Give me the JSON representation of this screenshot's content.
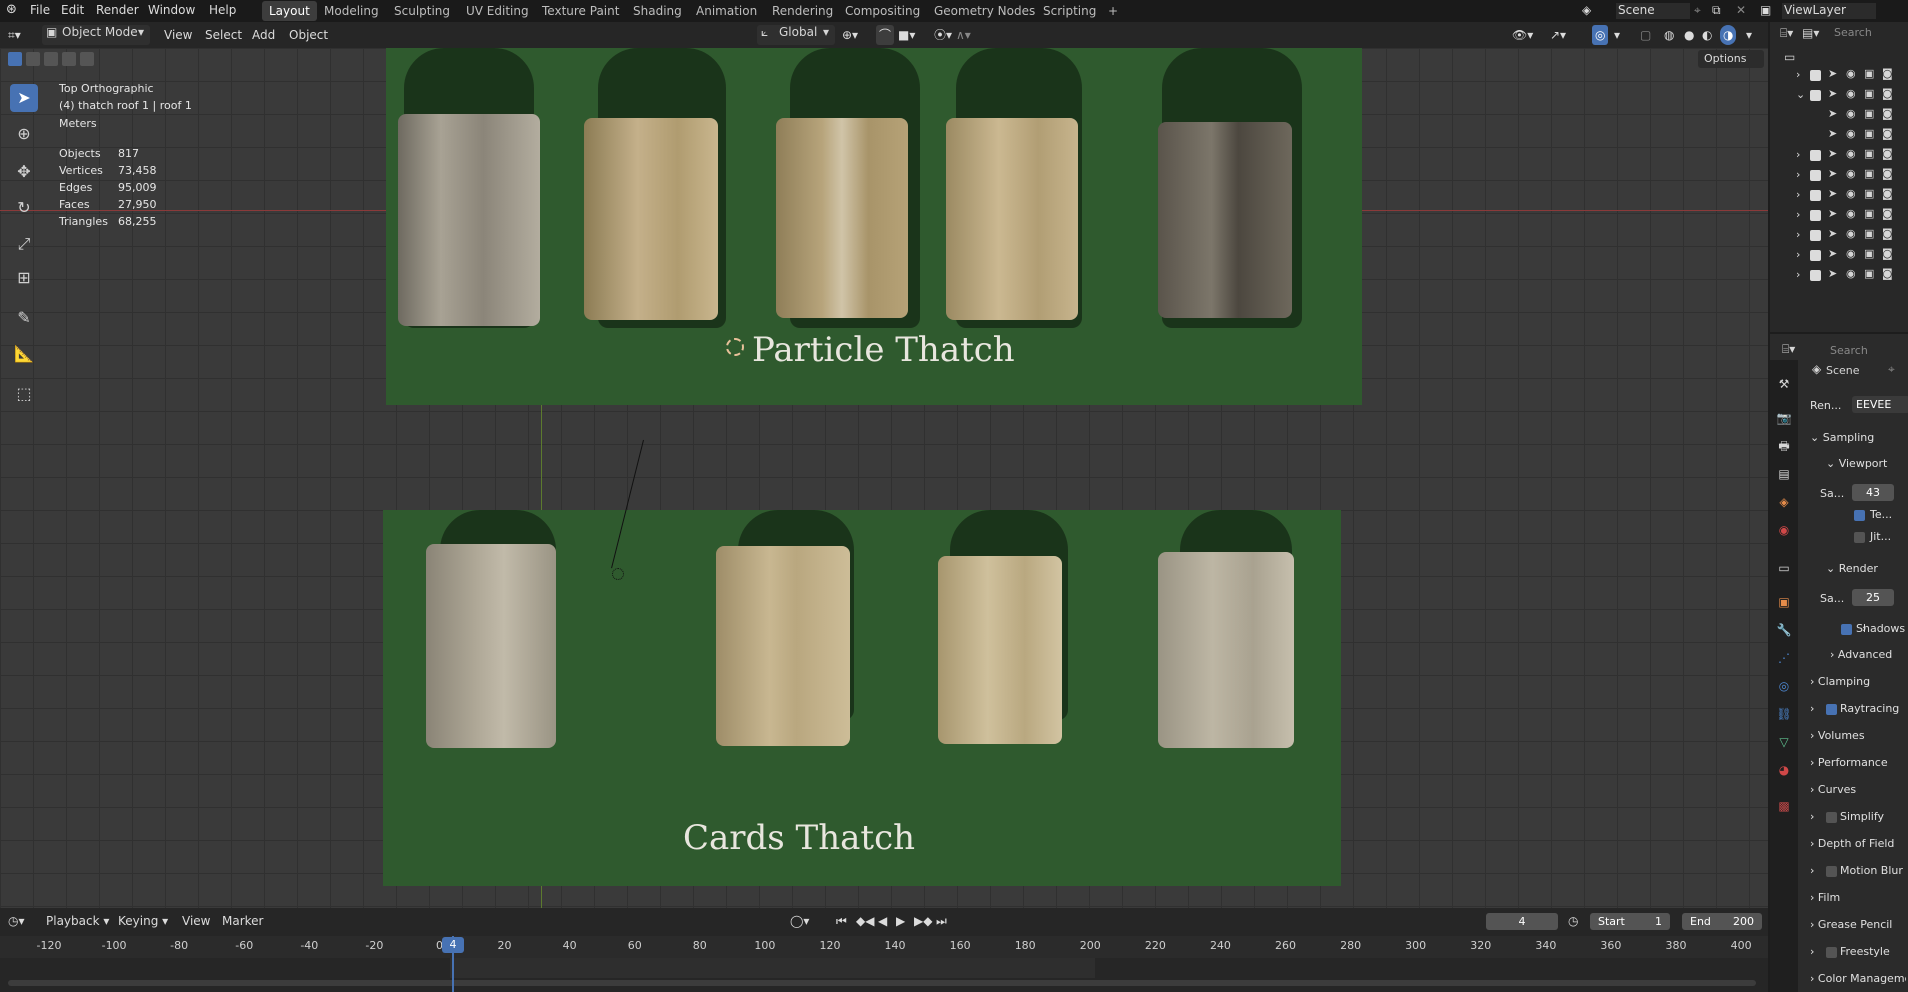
{
  "menu": [
    "File",
    "Edit",
    "Render",
    "Window",
    "Help"
  ],
  "workspaces": [
    "Layout",
    "Modeling",
    "Sculpting",
    "UV Editing",
    "Texture Paint",
    "Shading",
    "Animation",
    "Rendering",
    "Compositing",
    "Geometry Nodes",
    "Scripting",
    "+"
  ],
  "scene_name": "Scene",
  "view_layer": "ViewLayer",
  "header": {
    "mode": "Object Mode",
    "view": "View",
    "select": "Select",
    "add": "Add",
    "object": "Object",
    "transform_orientation": "Global",
    "options": "Options"
  },
  "overlay": {
    "view_name": "Top Orthographic",
    "active": "(4) thatch roof 1 | roof 1",
    "units": "Meters",
    "stats": [
      {
        "label": "Objects",
        "value": "817"
      },
      {
        "label": "Vertices",
        "value": "73,458"
      },
      {
        "label": "Edges",
        "value": "95,009"
      },
      {
        "label": "Faces",
        "value": "27,950"
      },
      {
        "label": "Triangles",
        "value": "68,255"
      }
    ]
  },
  "scene_labels": {
    "particle": "Particle Thatch",
    "cards": "Cards Thatch"
  },
  "colors": {
    "accent": "#4772b3",
    "plane": "#2f5a2e",
    "grid": "#3a3a3a"
  },
  "properties": {
    "search_placeholder": "Search",
    "scene": "Scene",
    "render_label": "Ren...",
    "render_engine": "EEVEE",
    "sections": {
      "sampling": "Sampling",
      "viewport": "Viewport",
      "samples_label": "Sa...",
      "viewport_samples": "43",
      "temporal_label": "Te...",
      "jitter_label": "Jit...",
      "render": "Render",
      "render_samples": "25",
      "shadows": "Shadows",
      "advanced": "Advanced",
      "clamping": "Clamping",
      "raytracing": "Raytracing",
      "volumes": "Volumes",
      "performance": "Performance",
      "curves": "Curves",
      "simplify": "Simplify",
      "dof": "Depth of Field",
      "motion_blur": "Motion Blur",
      "film": "Film",
      "grease_pencil": "Grease Pencil",
      "freestyle": "Freestyle",
      "color_management": "Color Management"
    }
  },
  "outliner": {
    "search_placeholder": "Search"
  },
  "timeline": {
    "playback": "Playback",
    "keying": "Keying",
    "view": "View",
    "marker": "Marker",
    "current_frame": "4",
    "start_label": "Start",
    "start": "1",
    "end_label": "End",
    "end": "200",
    "ticks": [
      "-120",
      "-100",
      "-80",
      "-60",
      "-40",
      "-20",
      "0",
      "20",
      "40",
      "60",
      "80",
      "100",
      "120",
      "140",
      "160",
      "180",
      "200",
      "220",
      "240",
      "260",
      "280",
      "300",
      "320",
      "340",
      "360",
      "380",
      "400"
    ]
  }
}
